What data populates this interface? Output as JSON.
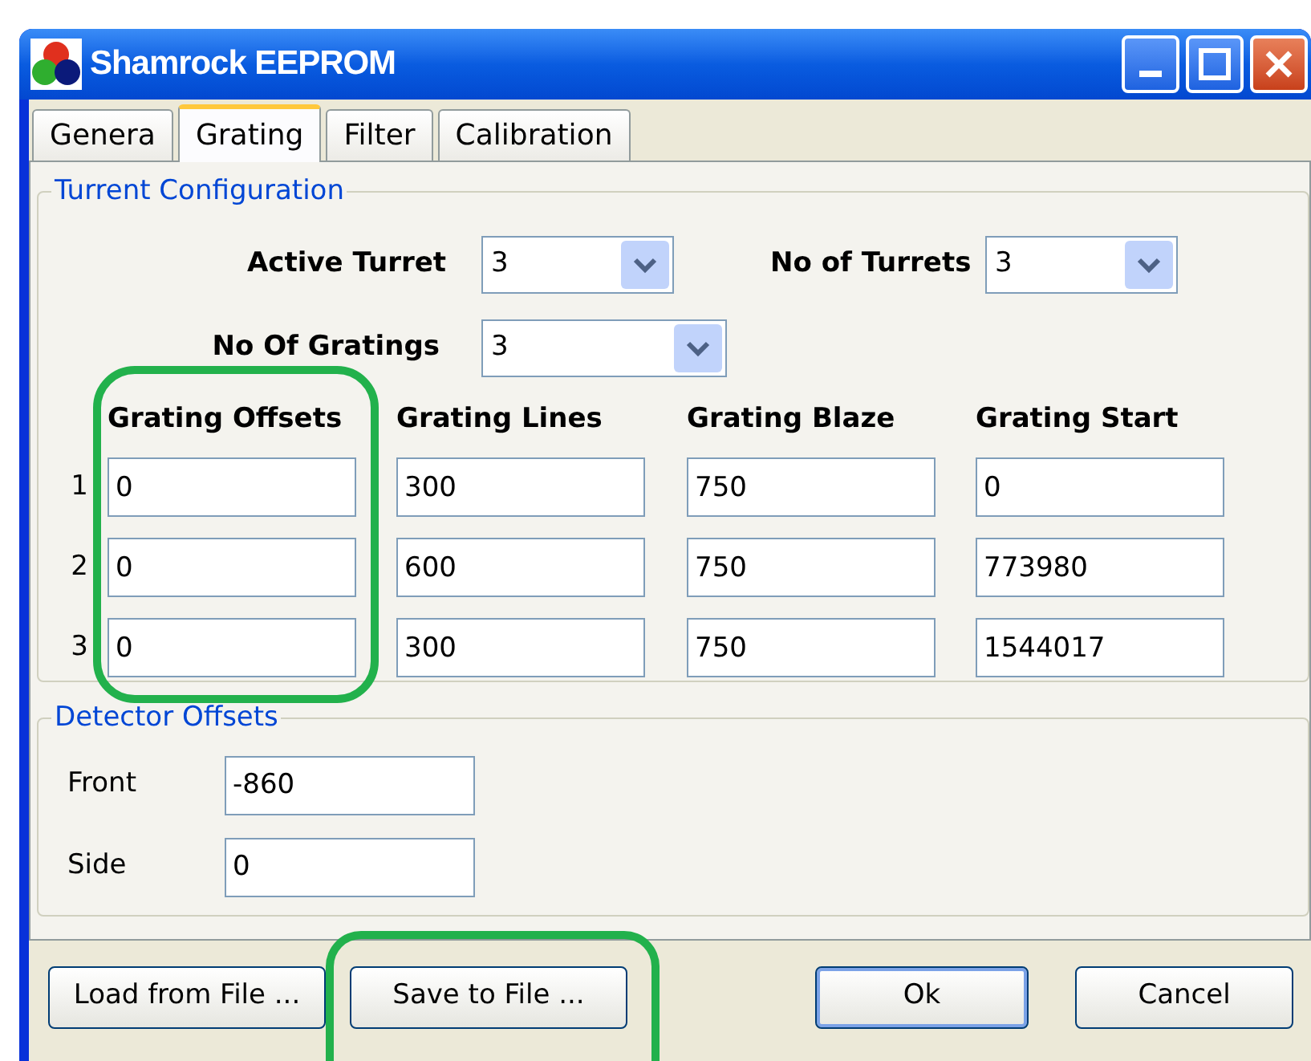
{
  "window": {
    "title": "Shamrock EEPROM"
  },
  "tabs": [
    {
      "label": "Genera",
      "selected": false
    },
    {
      "label": "Grating",
      "selected": true
    },
    {
      "label": "Filter",
      "selected": false
    },
    {
      "label": "Calibration",
      "selected": false
    }
  ],
  "turret_configuration": {
    "title": "Turrent Configuration",
    "active_turret": {
      "label": "Active Turret",
      "value": "3"
    },
    "no_of_turrets": {
      "label": "No of Turrets",
      "value": "3"
    },
    "no_of_gratings": {
      "label": "No Of Gratings",
      "value": "3"
    },
    "columns": [
      "Grating Offsets",
      "Grating Lines",
      "Grating Blaze",
      "Grating Start"
    ],
    "rows": [
      {
        "index": "1",
        "cells": [
          "0",
          "300",
          "750",
          "0"
        ]
      },
      {
        "index": "2",
        "cells": [
          "0",
          "600",
          "750",
          "773980"
        ]
      },
      {
        "index": "3",
        "cells": [
          "0",
          "300",
          "750",
          "1544017"
        ]
      }
    ]
  },
  "detector_offsets": {
    "title": "Detector Offsets",
    "fields": [
      {
        "label": "Front",
        "value": "-860"
      },
      {
        "label": "Side",
        "value": "0"
      }
    ]
  },
  "buttons": [
    {
      "label": "Load from File ...",
      "default": false
    },
    {
      "label": "Save to File ...",
      "default": false
    },
    {
      "label": "Ok",
      "default": true
    },
    {
      "label": "Cancel",
      "default": false
    }
  ]
}
